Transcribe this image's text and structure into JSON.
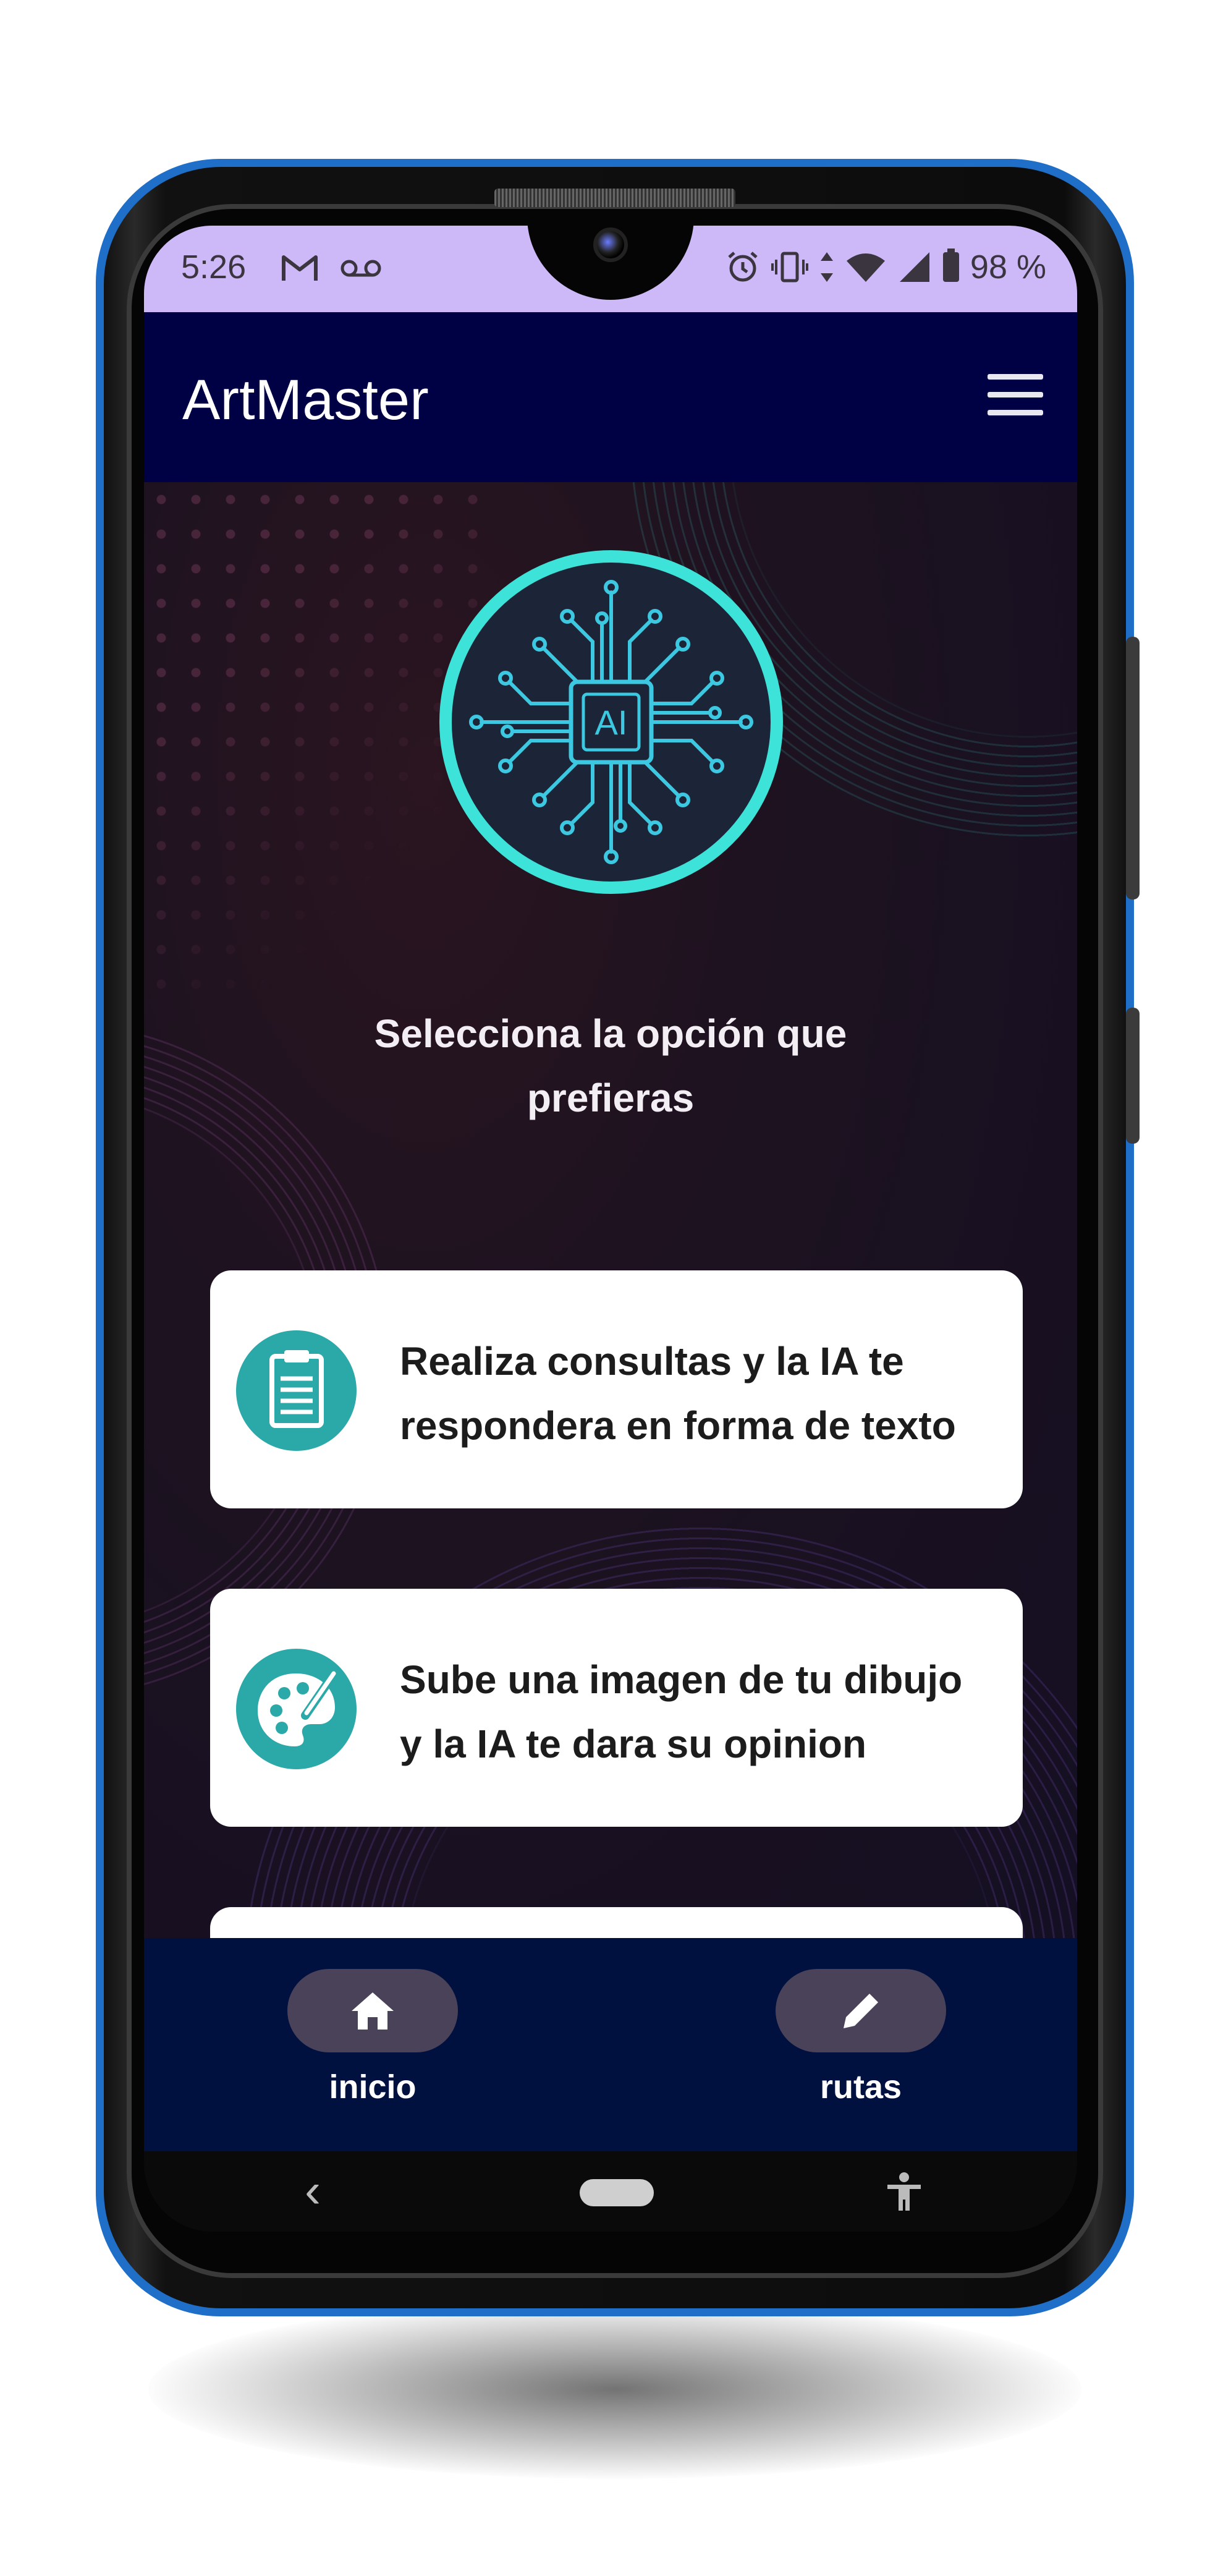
{
  "status_bar": {
    "time": "5:26",
    "left_icons": [
      "gmail-icon",
      "voicemail-icon"
    ],
    "right_icons": [
      "alarm-icon",
      "vibrate-icon",
      "data-arrows-icon",
      "wifi-icon",
      "signal-icon",
      "battery-icon"
    ],
    "battery": "98 %"
  },
  "app_bar": {
    "title": "ArtMaster",
    "menu_icon": "hamburger-menu-icon"
  },
  "main": {
    "logo_icon": "ai-chip-icon",
    "logo_text": "AI",
    "prompt_line1": "Selecciona la opción que",
    "prompt_line2": "prefieras",
    "options": [
      {
        "icon": "clipboard-icon",
        "line1": "Realiza consultas y la IA te",
        "line2": "respondera en forma de texto"
      },
      {
        "icon": "palette-icon",
        "line1": "Sube una imagen de tu dibujo",
        "line2": "y la IA te dara su opinion"
      },
      {
        "line1": "",
        "line2": ""
      }
    ]
  },
  "bottom_nav": {
    "items": [
      {
        "label": "inicio",
        "icon": "home-icon"
      },
      {
        "label": "rutas",
        "icon": "pencil-icon"
      }
    ]
  },
  "system_nav": {
    "back_glyph": "‹",
    "icons": [
      "back-icon",
      "home-pill-icon",
      "accessibility-icon"
    ]
  },
  "colors": {
    "status_bar": "#cdb8f8",
    "app_bar": "#000045",
    "bottom_nav": "#00103f",
    "accent_teal": "#2ba8a8",
    "logo_ring": "#3de3d8",
    "frame_blue": "#1f6fc9"
  }
}
